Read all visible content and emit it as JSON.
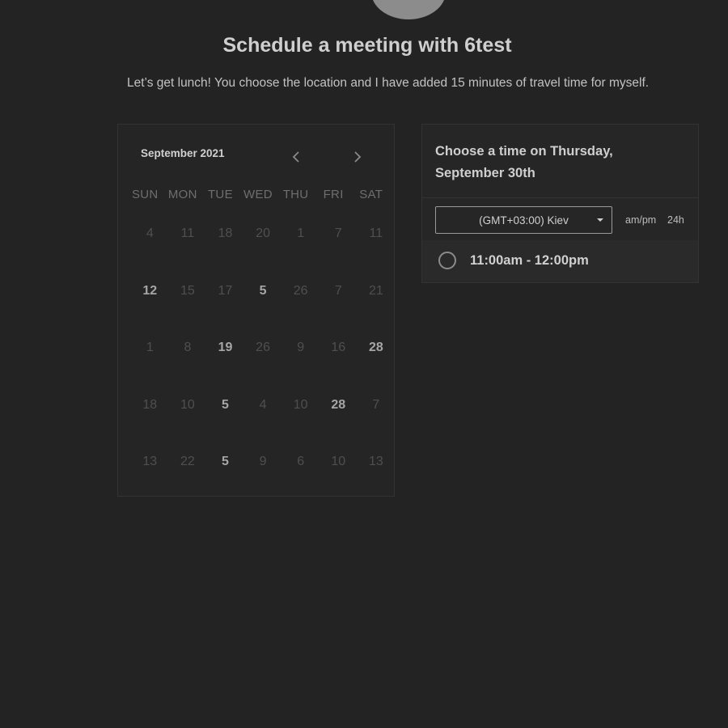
{
  "header": {
    "title": "Schedule a meeting with 6test",
    "subtitle": "Let’s get lunch! You choose the location and I have added 15 minutes of travel time for myself."
  },
  "calendar": {
    "month_label": "September 2021",
    "prev_icon": "chevron-left-icon",
    "next_icon": "chevron-right-icon",
    "weekdays": [
      "SUN",
      "MON",
      "TUE",
      "WED",
      "THU",
      "FRI",
      "SAT"
    ],
    "weeks": [
      [
        {
          "d": "4",
          "a": false
        },
        {
          "d": "11",
          "a": false
        },
        {
          "d": "18",
          "a": false
        },
        {
          "d": "20",
          "a": false
        },
        {
          "d": "1",
          "a": false
        },
        {
          "d": "7",
          "a": false
        },
        {
          "d": "11",
          "a": false
        }
      ],
      [
        {
          "d": "12",
          "a": true
        },
        {
          "d": "15",
          "a": false
        },
        {
          "d": "17",
          "a": false
        },
        {
          "d": "5",
          "a": true
        },
        {
          "d": "26",
          "a": false
        },
        {
          "d": "7",
          "a": false
        },
        {
          "d": "21",
          "a": false
        }
      ],
      [
        {
          "d": "1",
          "a": false
        },
        {
          "d": "8",
          "a": false
        },
        {
          "d": "19",
          "a": true
        },
        {
          "d": "26",
          "a": false
        },
        {
          "d": "9",
          "a": false
        },
        {
          "d": "16",
          "a": false
        },
        {
          "d": "28",
          "a": true
        }
      ],
      [
        {
          "d": "18",
          "a": false
        },
        {
          "d": "10",
          "a": false
        },
        {
          "d": "5",
          "a": true
        },
        {
          "d": "4",
          "a": false
        },
        {
          "d": "10",
          "a": false
        },
        {
          "d": "28",
          "a": true
        },
        {
          "d": "7",
          "a": false
        }
      ],
      [
        {
          "d": "13",
          "a": false
        },
        {
          "d": "22",
          "a": false
        },
        {
          "d": "5",
          "a": true
        },
        {
          "d": "9",
          "a": false
        },
        {
          "d": "6",
          "a": false
        },
        {
          "d": "10",
          "a": false
        },
        {
          "d": "13",
          "a": false
        }
      ]
    ]
  },
  "times": {
    "heading": "Choose a time on Thursday, September 30th",
    "timezone": "(GMT+03:00) Kiev",
    "format_ampm": "am/pm",
    "format_24h": "24h",
    "slots": [
      {
        "label": "11:00am - 12:00pm"
      }
    ]
  },
  "colors": {
    "background": "#232323",
    "available_day": "#a6a6a6",
    "unavailable_day": "#4f4f4f"
  }
}
